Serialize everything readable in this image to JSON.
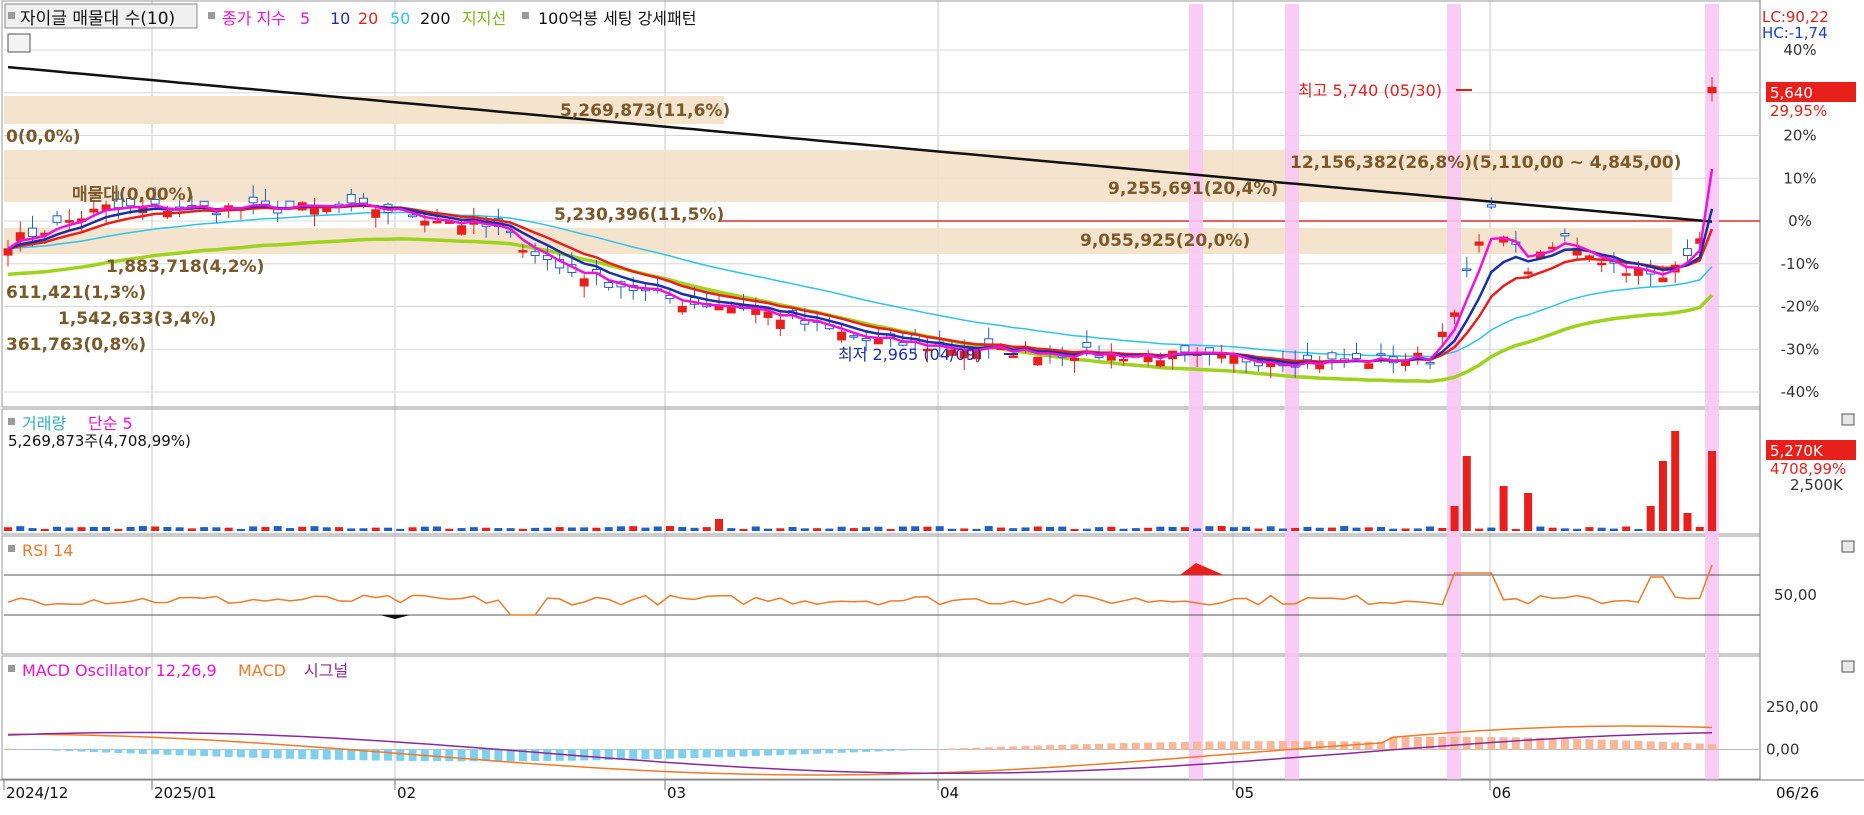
{
  "colors": {
    "up": "#e8201b",
    "down": "#1f5fc8",
    "ma5": "#f012d8",
    "ma10": "#1a2fa8",
    "ma20": "#e8201b",
    "ma50": "#2ec4e8",
    "ma200": "#111111",
    "support": "#9ed21e",
    "band": "#f3e1c8",
    "highlight": "#f8c6f4",
    "rsi": "#f07a2a",
    "macd": "#f07a2a",
    "signal": "#8a2a9a",
    "osc_pos": "#f6b79a",
    "osc_neg": "#7fd0ee"
  },
  "chart_data": [
    {
      "type": "candlestick",
      "panel": "price",
      "title_box": "자이글 매물대 수(10)",
      "legend": {
        "prefix": "종가 지수",
        "periods": [
          "5",
          "10",
          "20",
          "50",
          "200"
        ],
        "support_label": "지지선",
        "pattern_label": "100억봉 세팅 강세패턴"
      },
      "lc_label": "LC:90,22",
      "hc_label": "HC:-1,74",
      "y_axis_pct_ticks": [
        "40%",
        "30%",
        "20%",
        "10%",
        "0%",
        "-10%",
        "-20%",
        "-30%",
        "-40%"
      ],
      "y_range_pct": [
        -44,
        44
      ],
      "x_months": [
        "2024/12",
        "2025/01",
        "02",
        "03",
        "04",
        "05",
        "06"
      ],
      "x_end_label": "06/26",
      "current_price": "5,640",
      "current_pct": "29,95%",
      "annotations": {
        "high": "최고 5,740 (05/30)",
        "low": "최저 2,965 (04/09)"
      },
      "volume_profile": [
        {
          "label": "5,269,873(11,6%)",
          "bar_frac": 0.28
        },
        {
          "label": "0(0,0%)",
          "bar_frac": 0.0
        },
        {
          "label": "12,156,382(26,8%)(5,110,00 ~ 4,845,00)",
          "bar_frac": 0.95
        },
        {
          "label": "9,255,691(20,4%)",
          "bar_frac": 0.0
        },
        {
          "label": "매물대(0,00%)",
          "bar_frac": 0.0
        },
        {
          "label": "5,230,396(11,5%)",
          "bar_frac": 0.0
        },
        {
          "label": "9,055,925(20,0%)",
          "bar_frac": 0.95
        },
        {
          "label": "1,883,718(4,2%)",
          "bar_frac": 0.0
        },
        {
          "label": "611,421(1,3%)",
          "bar_frac": 0.0
        },
        {
          "label": "1,542,633(3,4%)",
          "bar_frac": 0.0
        },
        {
          "label": "361,763(0,8%)",
          "bar_frac": 0.0
        }
      ]
    },
    {
      "type": "bar",
      "panel": "volume",
      "legend": [
        "거래량",
        "단순 5"
      ],
      "info": "5,269,873주(4,708,99%)",
      "y_ticks": [
        "2,500K"
      ],
      "current_label": "5,270K",
      "current_pct": "4708,99%"
    },
    {
      "type": "line",
      "panel": "rsi",
      "legend": [
        "RSI 14"
      ],
      "y_ticks": [
        "50,00"
      ],
      "overbought": 70,
      "oversold": 30
    },
    {
      "type": "bar",
      "panel": "macd",
      "legend": [
        "MACD Oscillator 12,26,9",
        "MACD",
        "시그널"
      ],
      "y_ticks": [
        "250,00",
        "0,00"
      ]
    }
  ]
}
